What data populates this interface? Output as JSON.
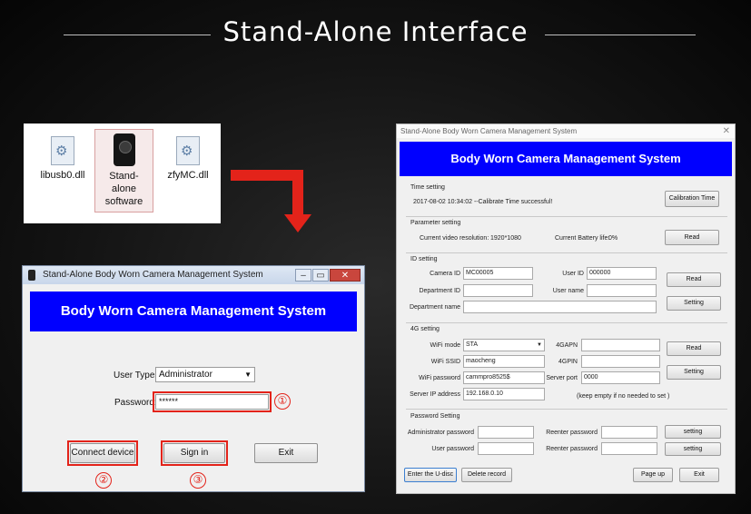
{
  "headline": "Stand-Alone Interface",
  "files": [
    {
      "name": "libusb0.dll",
      "icon": "dll-gear-icon"
    },
    {
      "name": "Stand-alone software",
      "icon": "body-camera-icon",
      "label_lines": [
        "Stand-",
        "alone",
        "software"
      ]
    },
    {
      "name": "zfyMC.dll",
      "icon": "dll-gear-icon"
    }
  ],
  "login_window": {
    "title": "Stand-Alone Body Worn Camera Management System",
    "banner": "Body Worn Camera Management System",
    "user_type_label": "User Type:",
    "user_type_value": "Administrator",
    "password_label": "Password:",
    "password_value": "******",
    "connect_button": "Connect device",
    "signin_button": "Sign in",
    "exit_button": "Exit",
    "step_markers": [
      "①",
      "②",
      "③"
    ],
    "controls": {
      "minimize": "–",
      "maximize": "▭",
      "close": "✕"
    }
  },
  "mgmt_window": {
    "title": "Stand-Alone Body Worn Camera Management System",
    "close_glyph": "✕",
    "banner": "Body Worn Camera Management System",
    "time_setting": {
      "title": "Time setting",
      "status": "2017-08-02 10:34:02 --Calibrate Time successful!",
      "button": "Calibration Time"
    },
    "parameter_setting": {
      "title": "Parameter setting",
      "resolution_label": "Current video resolution:",
      "resolution_value": "1920*1080",
      "battery_label": "Current Battery life:",
      "battery_value": "0%",
      "read_button": "Read"
    },
    "id_setting": {
      "title": "ID setting",
      "camera_id_label": "Camera ID",
      "camera_id_value": "MC00005",
      "user_id_label": "User ID",
      "user_id_value": "000000",
      "department_id_label": "Department ID",
      "department_id_value": "",
      "user_name_label": "User name",
      "user_name_value": "",
      "department_name_label": "Department name",
      "department_name_value": "",
      "read_button": "Read",
      "setting_button": "Setting"
    },
    "g4_setting": {
      "title": "4G setting",
      "wifi_mode_label": "WiFi mode",
      "wifi_mode_value": "STA",
      "apn_label": "4GAPN",
      "apn_value": "",
      "ssid_label": "WiFi SSID",
      "ssid_value": "maocheng",
      "pin_label": "4GPIN",
      "pin_value": "",
      "wifi_password_label": "WiFi password",
      "wifi_password_value": "cammpro8525$",
      "server_port_label": "Server port",
      "server_port_value": "0000",
      "server_ip_label": "Server IP address",
      "server_ip_value": "192.168.0.10",
      "note": "(keep empty if no needed to set )",
      "read_button": "Read",
      "setting_button": "Setting"
    },
    "password_setting": {
      "title": "Password Setting",
      "admin_password_label": "Administrator password",
      "user_password_label": "User password",
      "reenter_label_1": "Reenter password",
      "reenter_label_2": "Reenter password",
      "setting_button_1": "setting",
      "setting_button_2": "setting"
    },
    "footer": {
      "udisc_button": "Enter the U-disc",
      "delete_button": "Delete record",
      "pageup_button": "Page up",
      "exit_button": "Exit"
    }
  },
  "colors": {
    "banner_blue": "#0000ff",
    "highlight_red": "#e3231a"
  }
}
